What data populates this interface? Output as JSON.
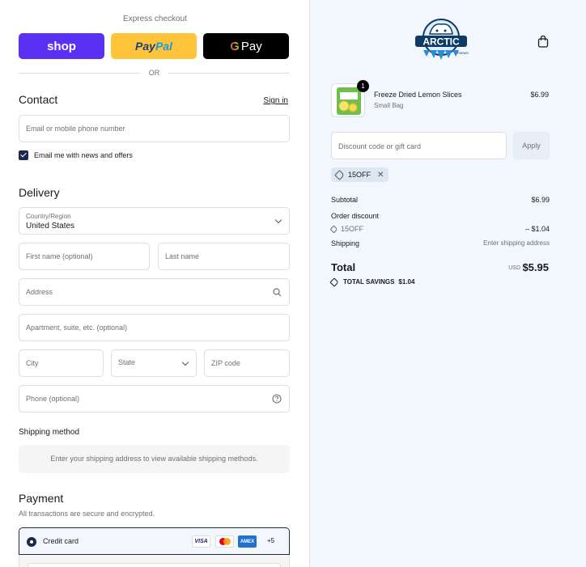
{
  "express": {
    "label": "Express checkout",
    "shop_label": "shop",
    "paypal_pay": "Pay",
    "paypal_pal": "Pal",
    "gpay_g": "G",
    "gpay_label": "Pay",
    "or_label": "OR"
  },
  "contact": {
    "title": "Contact",
    "sign_in": "Sign in",
    "email_placeholder": "Email or mobile phone number",
    "newsletter_label": "Email me with news and offers",
    "newsletter_checked": true
  },
  "delivery": {
    "title": "Delivery",
    "country_label": "Country/Region",
    "country_value": "United States",
    "first_name_placeholder": "First name (optional)",
    "last_name_placeholder": "Last name",
    "address_placeholder": "Address",
    "apartment_placeholder": "Apartment, suite, etc. (optional)",
    "city_placeholder": "City",
    "state_placeholder": "State",
    "zip_placeholder": "ZIP code",
    "phone_placeholder": "Phone (optional)"
  },
  "shipping_method": {
    "title": "Shipping method",
    "message": "Enter your shipping address to view available shipping methods."
  },
  "payment": {
    "title": "Payment",
    "subtitle": "All transactions are secure and encrypted.",
    "credit_card_label": "Credit card",
    "visa": "VISA",
    "amex": "AMEX",
    "more_cards": "+5"
  },
  "order": {
    "logo_text": "ARCTIC",
    "logo_subtext": "FARMS",
    "item": {
      "name": "Freeze Dried Lemon Slices",
      "variant": "Small Bag",
      "price": "$6.99",
      "quantity": "1"
    },
    "discount_placeholder": "Discount code or gift card",
    "apply_label": "Apply",
    "applied_code": "15OFF",
    "subtotal_label": "Subtotal",
    "subtotal_value": "$6.99",
    "order_discount_label": "Order discount",
    "discount_code": "15OFF",
    "discount_value": "– $1.04",
    "shipping_label": "Shipping",
    "shipping_value": "Enter shipping address",
    "total_label": "Total",
    "currency": "USD",
    "total_value": "$5.95",
    "savings_label": "TOTAL SAVINGS",
    "savings_value": "$1.04"
  },
  "colors": {
    "shop": "#5a31f4",
    "paypal": "#ffc439",
    "gpay": "#000000",
    "accent": "#1a2a50",
    "summary_bg": "#f1f7fc"
  }
}
